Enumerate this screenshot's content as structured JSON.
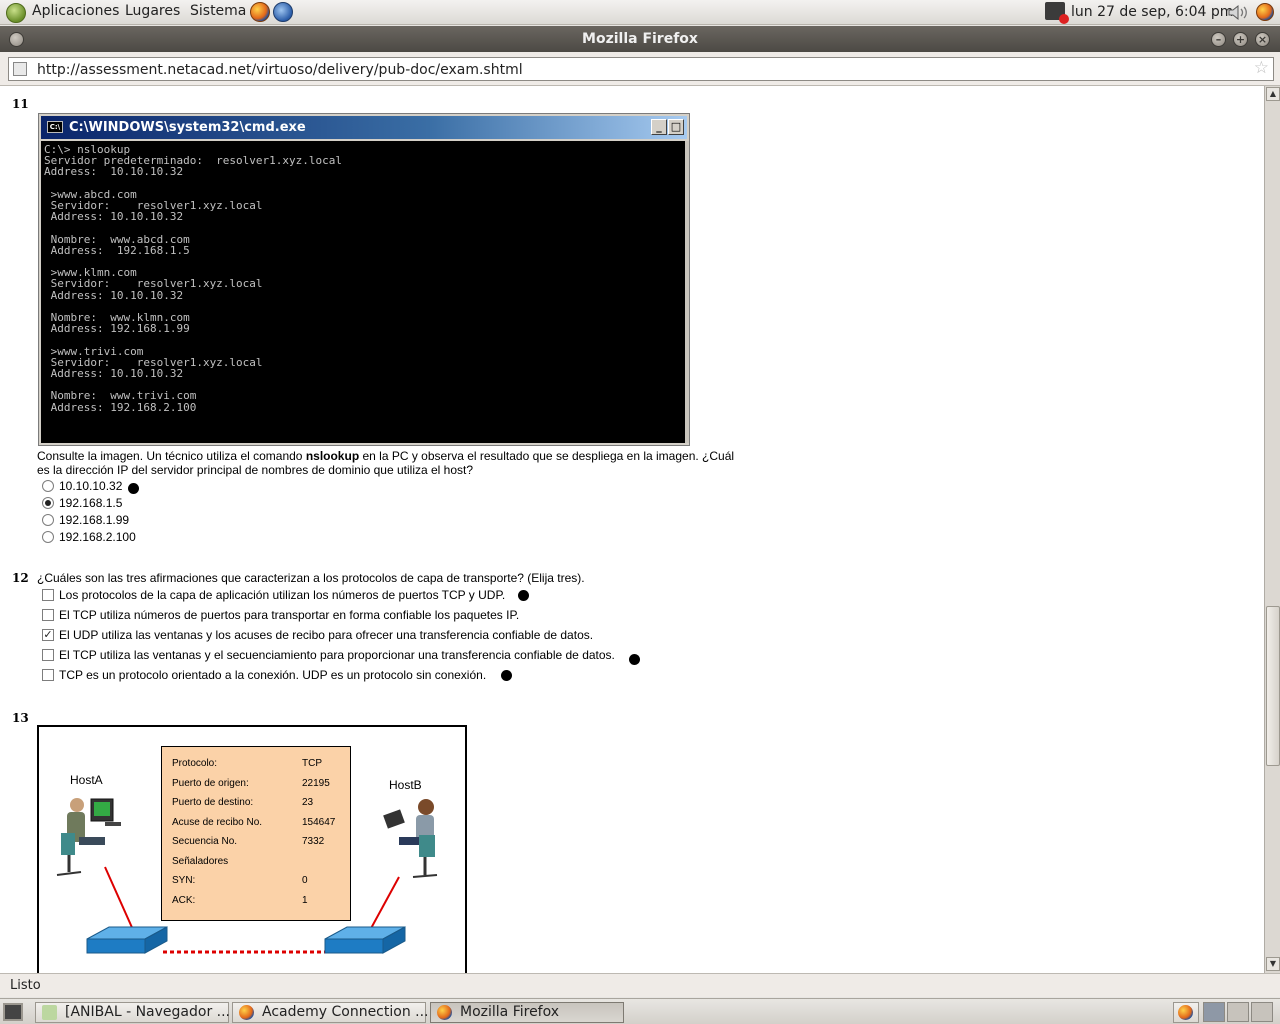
{
  "top_panel": {
    "menus": [
      "Aplicaciones",
      "Lugares",
      "Sistema"
    ],
    "clock": "lun 27 de sep,  6:04 pm"
  },
  "window": {
    "title": "Mozilla Firefox"
  },
  "navbar": {
    "url": "http://assessment.netacad.net/virtuoso/delivery/pub-doc/exam.shtml"
  },
  "q11": {
    "number": "11",
    "cmd_title": "C:\\WINDOWS\\system32\\cmd.exe",
    "cmd_icon": "C:\\",
    "console_lines": [
      "C:\\> nslookup",
      "Servidor predeterminado:  resolver1.xyz.local",
      "Address:  10.10.10.32",
      "",
      " >www.abcd.com",
      " Servidor:    resolver1.xyz.local",
      " Address: 10.10.10.32",
      "",
      " Nombre:  www.abcd.com",
      " Address:  192.168.1.5",
      "",
      " >www.klmn.com",
      " Servidor:    resolver1.xyz.local",
      " Address: 10.10.10.32",
      "",
      " Nombre:  www.klmn.com",
      " Address: 192.168.1.99",
      "",
      " >www.trivi.com",
      " Servidor:    resolver1.xyz.local",
      " Address: 10.10.10.32",
      "",
      " Nombre:  www.trivi.com",
      " Address: 192.168.2.100"
    ],
    "question_pre": "Consulte la imagen. Un técnico utiliza el comando ",
    "question_bold": "nslookup",
    "question_post": " en la PC y observa el resultado que se despliega en la imagen. ¿Cuál",
    "question_line2": "es la dirección IP del servidor principal de nombres de dominio que utiliza el host?",
    "options": [
      "10.10.10.32",
      "192.168.1.5",
      "192.168.1.99",
      "192.168.2.100"
    ]
  },
  "q12": {
    "number": "12",
    "question": "¿Cuáles son las tres afirmaciones que caracterizan a los protocolos de capa de transporte? (Elija tres).",
    "options": [
      "Los protocolos de la capa de aplicación utilizan los números de puertos TCP y UDP.",
      "El TCP utiliza números de puertos para transportar en forma confiable los paquetes IP.",
      "El UDP utiliza las ventanas y los acuses de recibo para ofrecer una transferencia confiable de datos.",
      "El TCP utiliza las ventanas y el secuenciamiento para proporcionar una transferencia confiable de datos.",
      "TCP es un protocolo orientado a la conexión. UDP es un protocolo sin conexión."
    ]
  },
  "q13": {
    "number": "13",
    "host_a": "HostA",
    "host_b": "HostB",
    "fields": [
      {
        "k": "Protocolo:",
        "v": "TCP"
      },
      {
        "k": "Puerto de origen:",
        "v": "22195"
      },
      {
        "k": "Puerto de destino:",
        "v": "23"
      },
      {
        "k": "Acuse de recibo No.",
        "v": "154647"
      },
      {
        "k": "Secuencia No.",
        "v": "7332"
      },
      {
        "k": "Señaladores",
        "v": ""
      },
      {
        "k": "SYN:",
        "v": "0"
      },
      {
        "k": "ACK:",
        "v": "1"
      }
    ]
  },
  "statusbar": {
    "text": "Listo"
  },
  "taskbar": [
    "[ANIBAL - Navegador ...",
    "Academy Connection ...",
    "Mozilla Firefox"
  ]
}
